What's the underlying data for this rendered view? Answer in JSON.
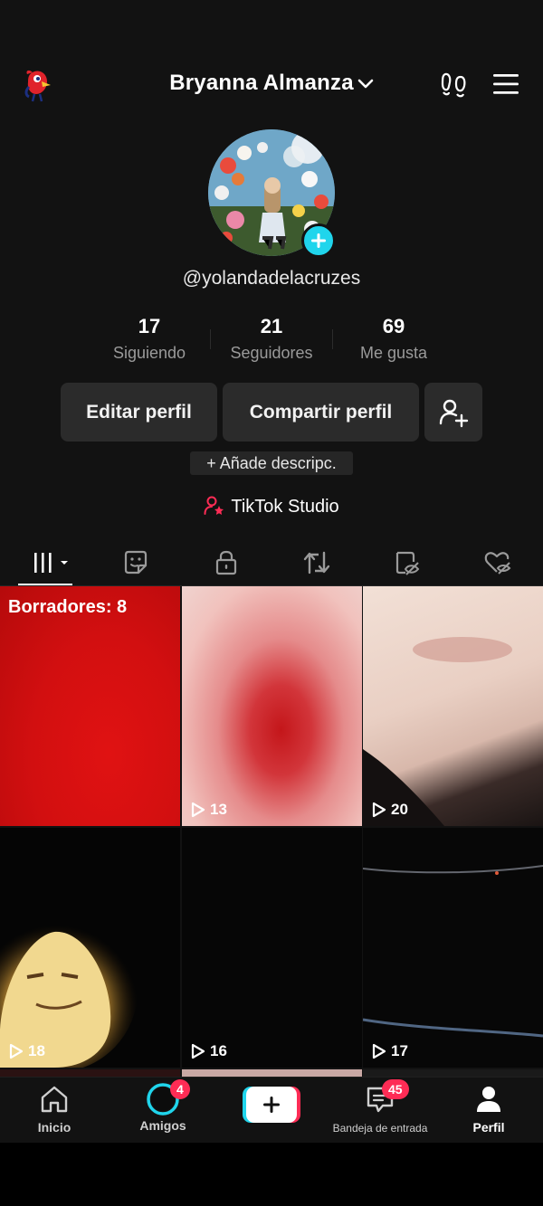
{
  "header": {
    "title": "Bryanna Almanza",
    "icons": [
      "mascot-icon",
      "chevron-down-icon",
      "footprint-icon",
      "menu-icon"
    ]
  },
  "profile": {
    "username": "@yolandadelacruzes",
    "stats": [
      {
        "value": "17",
        "label": "Siguiendo"
      },
      {
        "value": "21",
        "label": "Seguidores"
      },
      {
        "value": "69",
        "label": "Me gusta"
      }
    ],
    "edit_label": "Editar perfil",
    "share_label": "Compartir perfil",
    "add_description": "+ Añade descripc.",
    "studio_label": "TikTok Studio"
  },
  "tabs": [
    "videos",
    "stickers",
    "private",
    "reposts",
    "hidden",
    "liked"
  ],
  "grid": {
    "drafts_label": "Borradores: 8",
    "items": [
      {
        "views": "13"
      },
      {
        "views": "20"
      },
      {
        "views": "18"
      },
      {
        "views": "16"
      },
      {
        "views": "17"
      }
    ]
  },
  "nav": {
    "home": "Inicio",
    "friends": "Amigos",
    "friends_badge": "4",
    "inbox": "Bandeja de entrada",
    "inbox_badge": "45",
    "profile": "Perfil"
  },
  "colors": {
    "accent_cyan": "#20d5ec",
    "accent_pink": "#fe2c55",
    "background": "#121212"
  }
}
